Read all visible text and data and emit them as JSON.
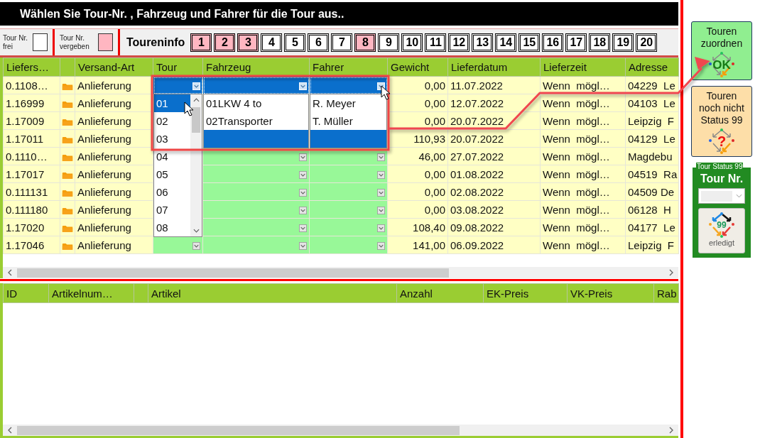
{
  "title": "Wählen Sie Tour-Nr. , Fahrzeug und Fahrer für die Tour aus..",
  "legend": [
    {
      "label": "Tour Nr. frei",
      "assigned": false
    },
    {
      "label": "Tour Nr. vergeben",
      "assigned": true
    }
  ],
  "tour_info": {
    "label": "Toureninfo",
    "tours": [
      {
        "label": "1",
        "assigned": true
      },
      {
        "label": "2",
        "assigned": true
      },
      {
        "label": "3",
        "assigned": true
      },
      {
        "label": "4",
        "assigned": false
      },
      {
        "label": "5",
        "assigned": false
      },
      {
        "label": "6",
        "assigned": false
      },
      {
        "label": "7",
        "assigned": false
      },
      {
        "label": "8",
        "assigned": true
      },
      {
        "label": "9",
        "assigned": false
      },
      {
        "label": "10",
        "assigned": false
      },
      {
        "label": "11",
        "assigned": false
      },
      {
        "label": "12",
        "assigned": false
      },
      {
        "label": "13",
        "assigned": false
      },
      {
        "label": "14",
        "assigned": false
      },
      {
        "label": "15",
        "assigned": false
      },
      {
        "label": "16",
        "assigned": false
      },
      {
        "label": "17",
        "assigned": false
      },
      {
        "label": "18",
        "assigned": false
      },
      {
        "label": "19",
        "assigned": false
      },
      {
        "label": "20",
        "assigned": false
      }
    ]
  },
  "orders": {
    "columns": [
      {
        "kind": "text",
        "label": "Liefers…"
      },
      {
        "kind": "icon"
      },
      {
        "kind": "text",
        "label": "Versand-Art"
      },
      {
        "kind": "combo",
        "label": "Tour"
      },
      {
        "kind": "combo",
        "label": "Fahrzeug"
      },
      {
        "kind": "combo",
        "label": "Fahrer"
      },
      {
        "kind": "number",
        "label": "Gewicht"
      },
      {
        "kind": "text",
        "label": "Lieferdatum"
      },
      {
        "kind": "text",
        "label": "Lieferzeit"
      },
      {
        "kind": "text",
        "label": "Adresse"
      }
    ],
    "rows": [
      {
        "cells": [
          "0.1108…",
          "",
          "Anlieferung",
          "",
          "",
          "",
          "0,00",
          "11.07.2022",
          "Wenn  mögl…",
          "04229  Le"
        ],
        "selected": true,
        "open_lists": [
          {
            "items": [
              {
                "label": "01",
                "selected": true
              },
              {
                "label": "02",
                "selected": false
              },
              {
                "label": "03",
                "selected": false
              },
              {
                "label": "04",
                "selected": false
              },
              {
                "label": "05",
                "selected": false
              },
              {
                "label": "06",
                "selected": false
              },
              {
                "label": "07",
                "selected": false
              },
              {
                "label": "08",
                "selected": false
              }
            ]
          },
          {
            "items": [
              {
                "label": "01LKW 4 to",
                "selected": false
              },
              {
                "label": "02Transporter",
                "selected": false
              },
              {
                "selected": true
              }
            ]
          },
          {
            "items": [
              {
                "label": "R. Meyer",
                "selected": false
              },
              {
                "label": "T. Müller",
                "selected": false
              },
              {
                "selected": true
              }
            ]
          }
        ]
      },
      {
        "cells": [
          "1.16999",
          "",
          "Anlieferung",
          "",
          "",
          "",
          "0,00",
          "12.07.2022",
          "Wenn  mögl…",
          "04103  Le"
        ],
        "selected": false
      },
      {
        "cells": [
          "1.17009",
          "",
          "Anlieferung",
          "",
          "",
          "",
          "0,00",
          "20.07.2022",
          "Wenn  mögl…",
          "Leipzig  F"
        ],
        "selected": false
      },
      {
        "cells": [
          "1.17011",
          "",
          "Anlieferung",
          "",
          "",
          "",
          "110,93",
          "20.07.2022",
          "Wenn  mögl…",
          "04129  Le"
        ],
        "selected": false
      },
      {
        "cells": [
          "0.1110…",
          "",
          "Anlieferung",
          "",
          "",
          "",
          "46,00",
          "27.07.2022",
          "Wenn  mögl…",
          "Magdebu"
        ],
        "selected": false
      },
      {
        "cells": [
          "1.17017",
          "",
          "Anlieferung",
          "",
          "",
          "",
          "0,00",
          "01.08.2022",
          "Wenn  mögl…",
          "04519  Ra"
        ],
        "selected": false
      },
      {
        "cells": [
          "0.111131",
          "",
          "Anlieferung",
          "",
          "",
          "",
          "0,00",
          "02.08.2022",
          "Wenn  mögl…",
          "04509 De"
        ],
        "selected": false
      },
      {
        "cells": [
          "0.111180",
          "",
          "Anlieferung",
          "",
          "",
          "",
          "0,00",
          "03.08.2022",
          "Wenn  mögl…",
          "06128  H"
        ],
        "selected": false
      },
      {
        "cells": [
          "1.17020",
          "",
          "Anlieferung",
          "",
          "",
          "",
          "108,40",
          "09.08.2022",
          "Wenn  mögl…",
          "04177  Le"
        ],
        "selected": false
      },
      {
        "cells": [
          "1.17046",
          "",
          "Anlieferung",
          "",
          "",
          "",
          "141,00",
          "06.09.2022",
          "Wenn  mögl…",
          "Leipzig  F"
        ],
        "selected": false
      }
    ]
  },
  "articles": {
    "columns": [
      {
        "kind": "text",
        "label": "ID"
      },
      {
        "kind": "text",
        "label": "Artikelnum…"
      },
      {
        "kind": "spacer"
      },
      {
        "kind": "text",
        "label": "Artikel"
      },
      {
        "kind": "text",
        "label": "Anzahl"
      },
      {
        "kind": "text",
        "label": "EK-Preis"
      },
      {
        "kind": "text",
        "label": "VK-Preis"
      },
      {
        "kind": "text",
        "label": "Rab"
      }
    ]
  },
  "side": {
    "buttons": [
      {
        "kind": "assign",
        "label": "Touren zuordnen",
        "icon_text": "OK"
      },
      {
        "kind": "pending",
        "label": "Touren noch nicht Status 99",
        "icon_text": "?"
      }
    ],
    "group": {
      "title": "Tour Status 99",
      "label": "Tour Nr.",
      "combo_disabled": true,
      "done_button": {
        "label": "erledigt",
        "icon_text": "99"
      }
    }
  }
}
